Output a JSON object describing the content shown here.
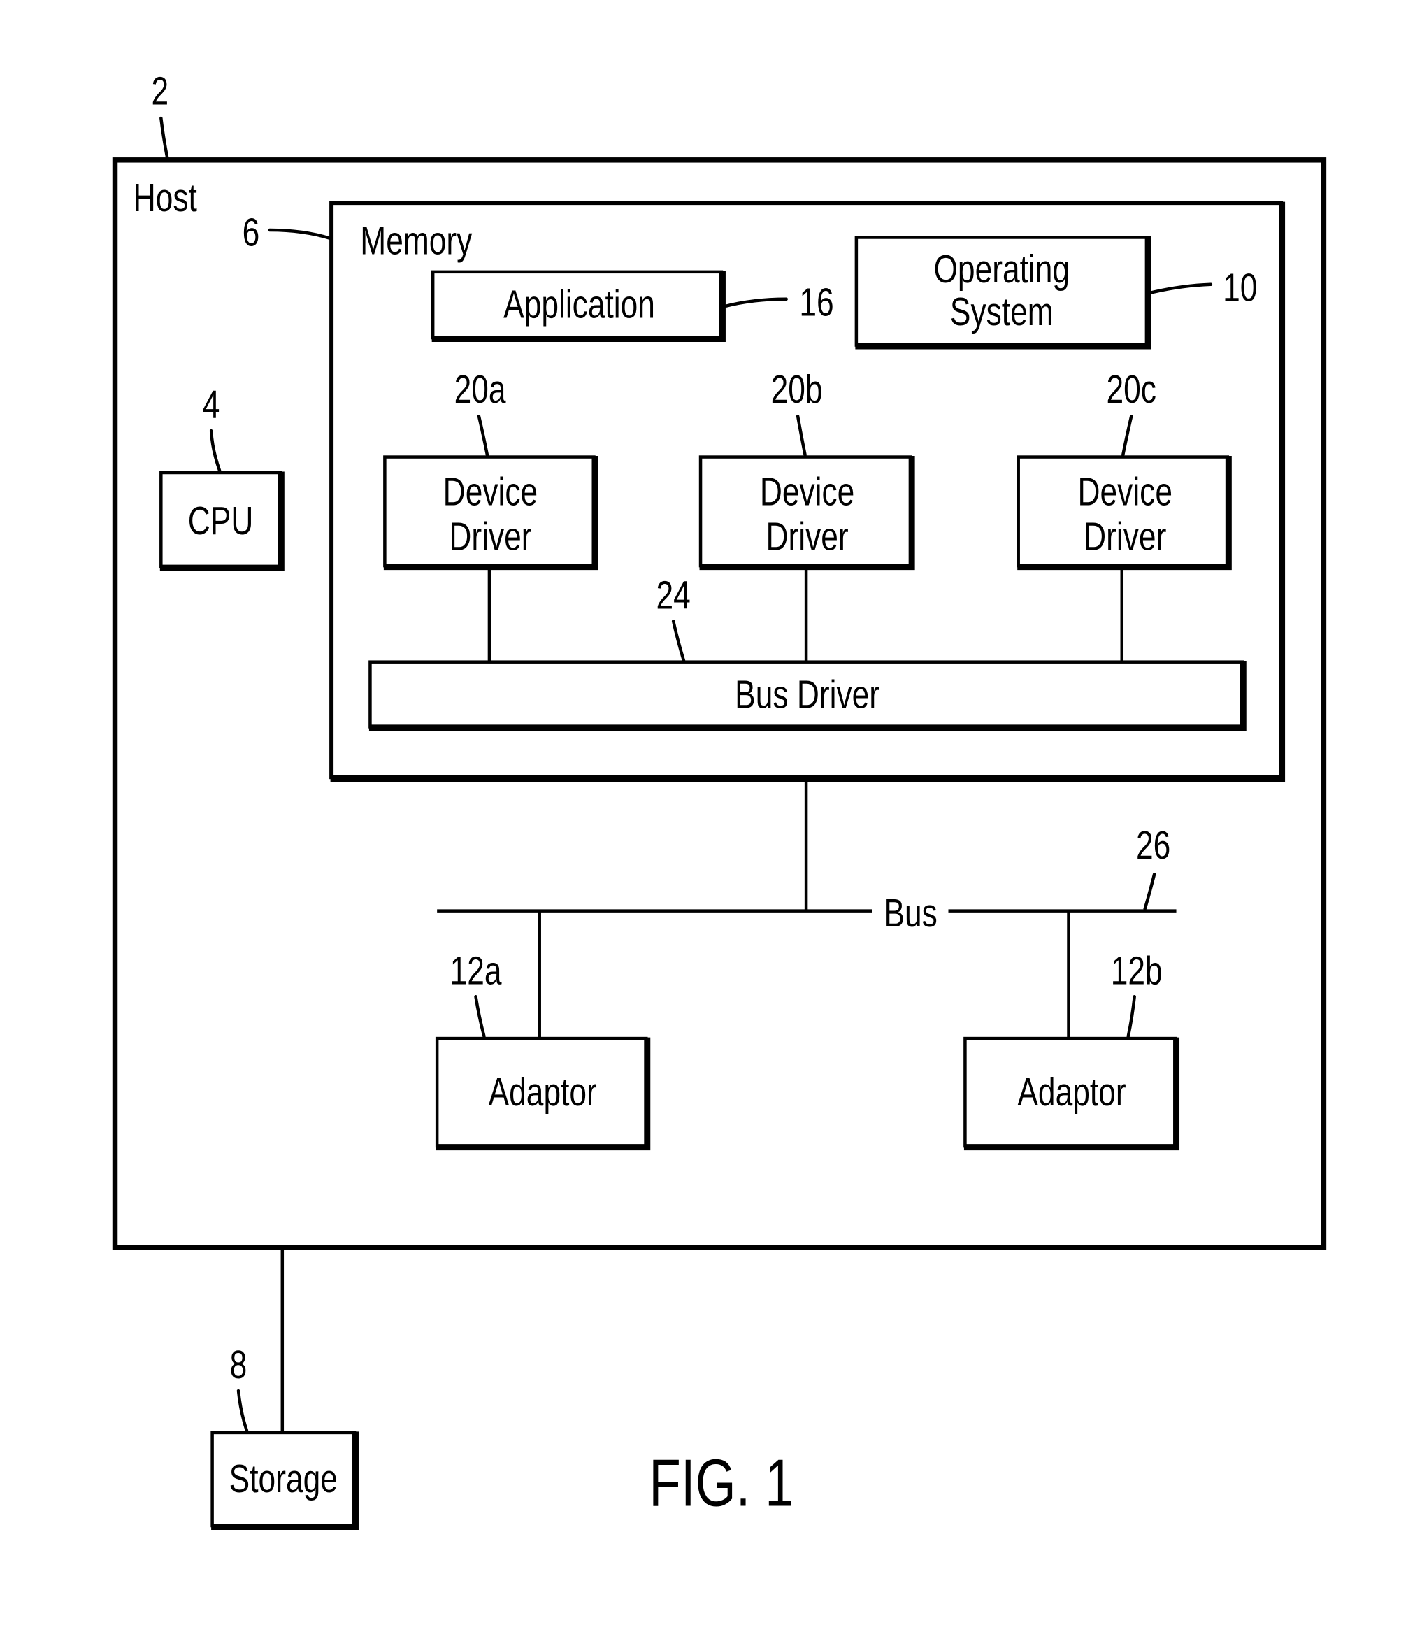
{
  "figure": {
    "caption": "FIG. 1",
    "host": {
      "label": "Host",
      "ref": "2"
    },
    "cpu": {
      "label": "CPU",
      "ref": "4"
    },
    "memory": {
      "label": "Memory",
      "ref": "6"
    },
    "storage": {
      "label": "Storage",
      "ref": "8"
    },
    "operating_system": {
      "label_line1": "Operating",
      "label_line2": "System",
      "ref": "10"
    },
    "application": {
      "label": "Application",
      "ref": "16"
    },
    "device_drivers": [
      {
        "label_line1": "Device",
        "label_line2": "Driver",
        "ref": "20a"
      },
      {
        "label_line1": "Device",
        "label_line2": "Driver",
        "ref": "20b"
      },
      {
        "label_line1": "Device",
        "label_line2": "Driver",
        "ref": "20c"
      }
    ],
    "bus_driver": {
      "label": "Bus Driver",
      "ref": "24"
    },
    "bus": {
      "label": "Bus",
      "ref": "26"
    },
    "adaptors": [
      {
        "label": "Adaptor",
        "ref": "12a"
      },
      {
        "label": "Adaptor",
        "ref": "12b"
      }
    ]
  }
}
